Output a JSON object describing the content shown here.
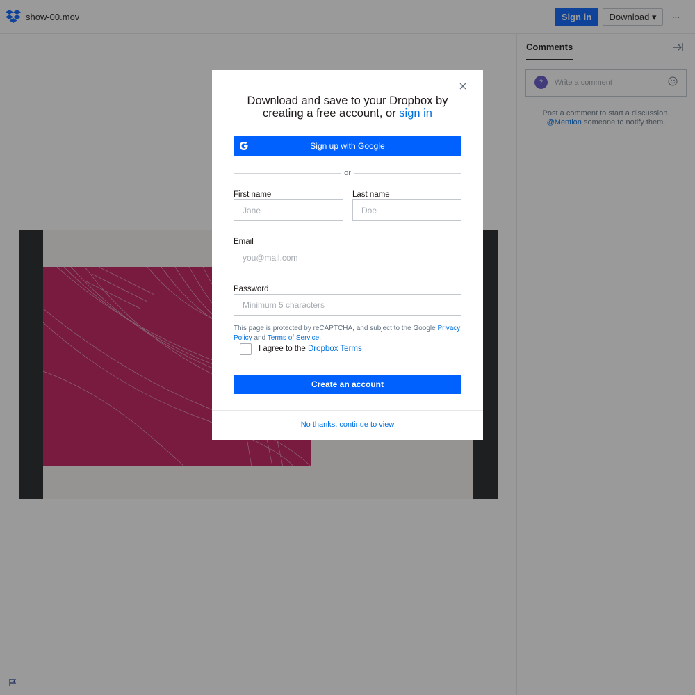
{
  "header": {
    "filename": "show-00.mov",
    "signin_label": "Sign in",
    "download_label": "Download ▾",
    "more_label": "···"
  },
  "sidebar": {
    "tab_comments": "Comments",
    "comment_placeholder": "Write a comment",
    "avatar_label": "?",
    "hint_line1": "Post a comment to start a discussion.",
    "hint_mention": "@Mention",
    "hint_line2": " someone to notify them."
  },
  "modal": {
    "title": "Download and save to your Dropbox by creating a free account, or ",
    "title_link": "sign in",
    "google_label": "Sign up with Google",
    "or_label": "or",
    "first_name_label": "First name",
    "first_name_placeholder": "Jane",
    "last_name_label": "Last name",
    "last_name_placeholder": "Doe",
    "email_label": "Email",
    "email_placeholder": "you@mail.com",
    "password_label": "Password",
    "password_placeholder": "Minimum 5 characters",
    "captcha_prefix": "This page is protected by reCAPTCHA, and subject to the Google ",
    "captcha_privacy": "Privacy Policy",
    "captcha_and": " and ",
    "captcha_terms": "Terms of Service",
    "captcha_suffix": ".",
    "agree_prefix": "I agree to the ",
    "agree_link": "Dropbox Terms",
    "create_label": "Create an account",
    "no_thanks_label": "No thanks, continue to view"
  },
  "colors": {
    "brand": "#0061fe",
    "link": "#0070e0",
    "video_art": "#c3175a"
  },
  "icons": [
    "dropbox-logo",
    "google-icon",
    "close-icon",
    "emoji-icon",
    "collapse-panel-icon",
    "flag-icon"
  ]
}
